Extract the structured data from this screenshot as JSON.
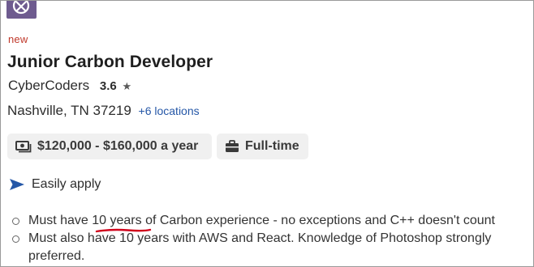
{
  "job": {
    "badge": "new",
    "title": "Junior Carbon Developer",
    "company": "CyberCoders",
    "rating": "3.6",
    "rating_star": "★",
    "location": "Nashville, TN 37219",
    "more_locations": "+6 locations",
    "salary": "$120,000 - $160,000 a year",
    "job_type": "Full-time",
    "apply_label": "Easily apply",
    "requirements": [
      {
        "before": "Must have ",
        "highlight": "10 years",
        "after": " of Carbon experience - no exceptions and C++ doesn't count"
      },
      {
        "line1": "Must also have 10 years with AWS and React. Knowledge of Photoshop strongly",
        "line2": "preferred."
      }
    ]
  },
  "colors": {
    "logo_bg": "#6e5b8f",
    "badge": "#c0392b",
    "link": "#2557a7",
    "apply_arrow": "#2557a7",
    "chip_bg": "#f0f0f0",
    "annotation_underline": "#d0021b"
  },
  "icons": {
    "logo": "company-logo-icon",
    "salary": "money-icon",
    "job_type": "briefcase-icon",
    "apply": "send-arrow-icon"
  }
}
